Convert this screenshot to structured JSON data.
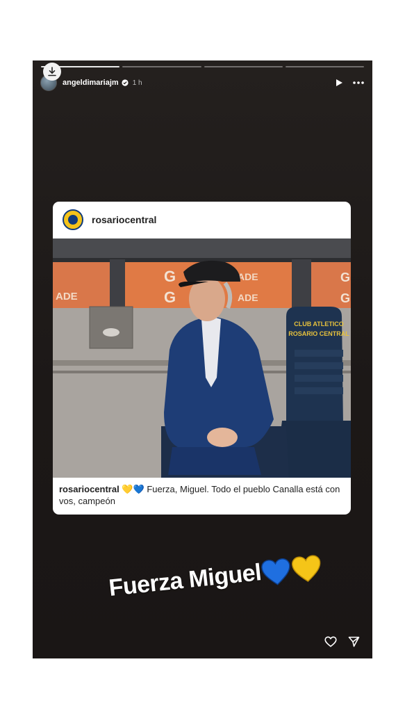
{
  "story": {
    "username": "angeldimariajm",
    "time_ago": "1 h",
    "progress_segments": 4,
    "progress_completed": 1
  },
  "post": {
    "account": "rosariocentral",
    "caption_user": "rosariocentral",
    "caption_hearts": "💛💙",
    "caption_text": "Fuerza, Miguel. Todo el pueblo Canalla está con vos, campeón",
    "photo": {
      "banner_text_a": "G",
      "banner_text_b": "ADE",
      "seat_text_line1": "CLUB ATLETICO",
      "seat_text_line2": "ROSARIO CENTRAL"
    }
  },
  "sticker": {
    "text": "Fuerza Miguel"
  },
  "colors": {
    "story_bg": "#1f1b1a",
    "heart_blue": "#1f6fe0",
    "heart_yellow": "#f5c518",
    "club_yellow": "#f4c31a",
    "club_blue": "#103a7a",
    "banner_orange": "#e07a45"
  },
  "icons": {
    "download": "download-icon",
    "verified": "verified-badge-icon",
    "play": "play-icon",
    "more": "more-options-icon",
    "like": "heart-outline-icon",
    "share": "send-icon"
  }
}
